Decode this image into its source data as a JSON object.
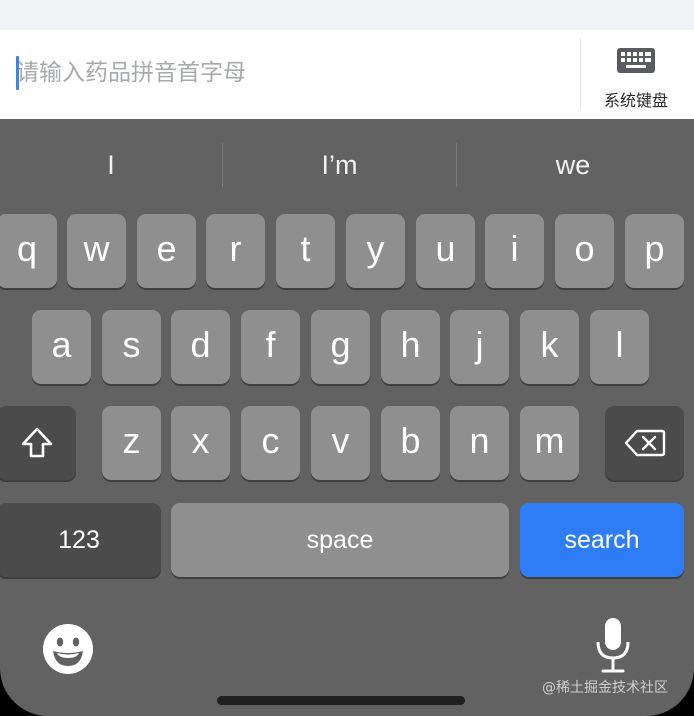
{
  "search": {
    "placeholder": "请输入药品拼音首字母",
    "value": ""
  },
  "system_keyboard": {
    "label": "系统键盘",
    "icon": "keyboard-icon"
  },
  "suggestions": [
    "I",
    "I’m",
    "we"
  ],
  "keys": {
    "row1": [
      "q",
      "w",
      "e",
      "r",
      "t",
      "y",
      "u",
      "i",
      "o",
      "p"
    ],
    "row2": [
      "a",
      "s",
      "d",
      "f",
      "g",
      "h",
      "j",
      "k",
      "l"
    ],
    "row3": [
      "z",
      "x",
      "c",
      "v",
      "b",
      "n",
      "m"
    ],
    "shift_icon": "shift-icon",
    "backspace_icon": "backspace-icon",
    "numbers_label": "123",
    "space_label": "space",
    "search_label": "search",
    "emoji_icon": "emoji-icon",
    "mic_icon": "microphone-icon"
  },
  "watermark": "@稀土掘金技术社区",
  "colors": {
    "accent": "#2f7df6",
    "keyboard_bg": "#626263",
    "key": "#8f8f90",
    "key_dark": "#4b4b4c"
  }
}
